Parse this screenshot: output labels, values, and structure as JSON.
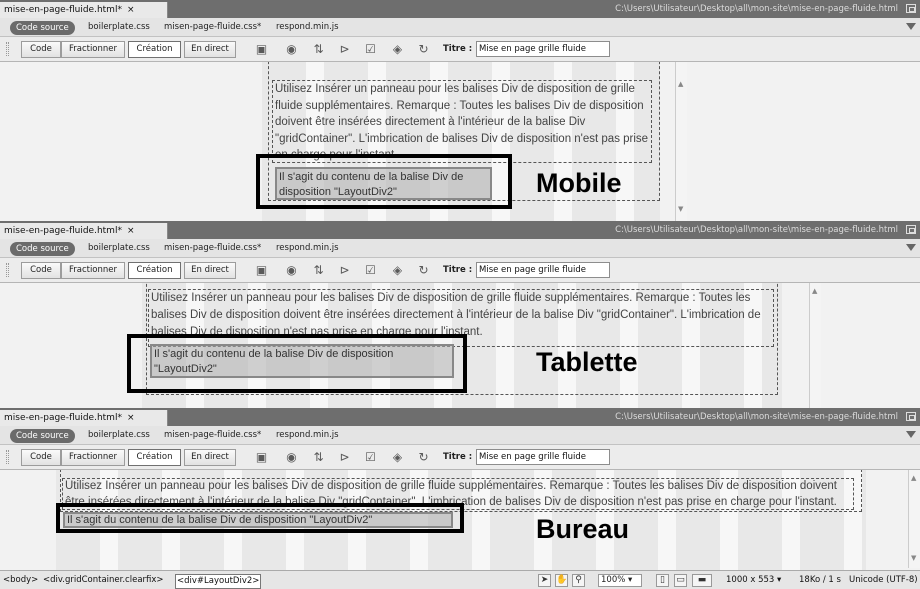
{
  "panels": [
    {
      "doc_tab": "mise-en-page-fluide.html*",
      "path": "C:\\Users\\Utilisateur\\Desktop\\all\\mon-site\\mise-en-page-fluide.html",
      "related_files": [
        "Code source",
        "boilerplate.css",
        "misen-page-fluide.css*",
        "respond.min.js"
      ],
      "views": [
        "Code",
        "Fractionner",
        "Création",
        "En direct"
      ],
      "title_label": "Titre :",
      "title_value": "Mise en page grille fluide",
      "div1_text": "Utilisez Insérer un panneau pour les balises Div de disposition de grille fluide supplémentaires. Remarque : Toutes les balises Div de disposition doivent être insérées directement à l'intérieur de la balise Div \"gridContainer\". L'imbrication de balises Div de disposition n'est pas prise en charge pour l'instant.",
      "div2_text": "Il s'agit du contenu de la balise Div de disposition \"LayoutDiv2\"",
      "label": "Mobile"
    },
    {
      "doc_tab": "mise-en-page-fluide.html*",
      "path": "C:\\Users\\Utilisateur\\Desktop\\all\\mon-site\\mise-en-page-fluide.html",
      "related_files": [
        "Code source",
        "boilerplate.css",
        "misen-page-fluide.css*",
        "respond.min.js"
      ],
      "views": [
        "Code",
        "Fractionner",
        "Création",
        "En direct"
      ],
      "title_label": "Titre :",
      "title_value": "Mise en page grille fluide",
      "div1_text": "Utilisez Insérer un panneau pour les balises Div de disposition de grille fluide supplémentaires. Remarque : Toutes les balises Div de disposition doivent être insérées directement à l'intérieur de la balise Div \"gridContainer\". L'imbrication de balises Div de disposition n'est pas prise en charge pour l'instant.",
      "div2_text": "Il s'agit du contenu de la balise Div de disposition \"LayoutDiv2\"",
      "label": "Tablette"
    },
    {
      "doc_tab": "mise-en-page-fluide.html*",
      "path": "C:\\Users\\Utilisateur\\Desktop\\all\\mon-site\\mise-en-page-fluide.html",
      "related_files": [
        "Code source",
        "boilerplate.css",
        "misen-page-fluide.css*",
        "respond.min.js"
      ],
      "views": [
        "Code",
        "Fractionner",
        "Création",
        "En direct"
      ],
      "title_label": "Titre :",
      "title_value": "Mise en page grille fluide",
      "div1_text": "Utilisez Insérer un panneau pour les balises Div de disposition de grille fluide supplémentaires. Remarque : Toutes les balises Div de disposition doivent être insérées directement à l'intérieur de la balise Div \"gridContainer\". L'imbrication de balises Div de disposition n'est pas prise en charge pour l'instant.",
      "div2_text": "Il s'agit du contenu de la balise Div de disposition \"LayoutDiv2\"",
      "label": "Bureau"
    }
  ],
  "toolbar_icons": [
    "inspect-icon",
    "live-view-icon",
    "file-management-icon",
    "preview-icon",
    "validate-icon",
    "visual-aids-icon",
    "refresh-icon"
  ],
  "status": {
    "tags": [
      "<body>",
      "<div.gridContainer.clearfix>",
      "<div#LayoutDiv2>"
    ],
    "zoom": "100%",
    "window_size": "1000 x 553",
    "download": "18Ko / 1 s",
    "encoding": "Unicode (UTF-8)"
  },
  "colors": {
    "tabbar": "#6e6e6e",
    "annotation": "#000000",
    "div2_fill": "#afafaf"
  }
}
